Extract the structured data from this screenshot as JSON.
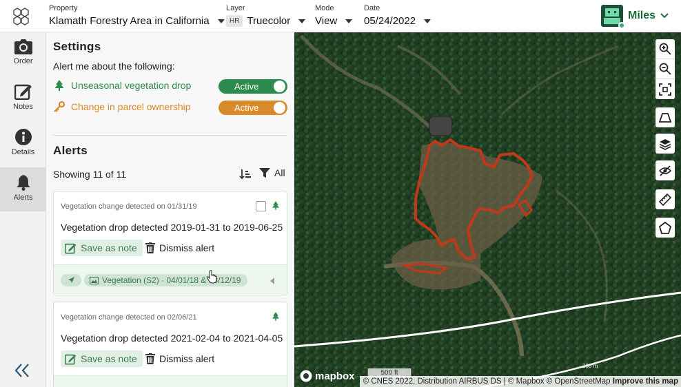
{
  "header": {
    "property": {
      "label": "Property",
      "value": "Klamath Forestry Area in California"
    },
    "layer": {
      "label": "Layer",
      "badge": "HR",
      "value": "Truecolor"
    },
    "mode": {
      "label": "Mode",
      "value": "View"
    },
    "date": {
      "label": "Date",
      "value": "05/24/2022"
    },
    "user": {
      "name": "Miles"
    }
  },
  "rail": {
    "items": [
      {
        "label": "Order",
        "icon": "camera-icon"
      },
      {
        "label": "Notes",
        "icon": "edit-icon"
      },
      {
        "label": "Details",
        "icon": "info-icon"
      },
      {
        "label": "Alerts",
        "icon": "bell-icon",
        "active": true
      }
    ]
  },
  "settings": {
    "title": "Settings",
    "intro": "Alert me about the following:",
    "rules": [
      {
        "label": "Unseasonal vegetation drop",
        "state": "Active",
        "color": "#2e8b4e",
        "icon": "tree-icon"
      },
      {
        "label": "Change in parcel ownership",
        "state": "Active",
        "color": "#d98a2b",
        "icon": "key-icon"
      }
    ]
  },
  "alerts": {
    "title": "Alerts",
    "showing": "Showing 11 of 11",
    "filter": "All",
    "cards": [
      {
        "detected": "Vegetation change detected on 01/31/19",
        "title": "Vegetation drop detected 2019-01-31 to 2019-06-25",
        "save": "Save as note",
        "dismiss": "Dismiss alert",
        "layer_pill": "Vegetation (S2) · 04/01/18 & 08/12/19"
      },
      {
        "detected": "Vegetation change detected on 02/06/21",
        "title": "Vegetation drop detected 2021-02-04 to 2021-04-05",
        "save": "Save as note",
        "dismiss": "Dismiss alert"
      }
    ]
  },
  "map": {
    "logo": "mapbox",
    "scale": "500 ft",
    "contour_label": "200 m",
    "attribution": {
      "text": "© CNES 2022, Distribution AIRBUS DS | © Mapbox © OpenStreetMap",
      "improve": "Improve this map"
    },
    "controls": [
      "zoom-in-icon",
      "zoom-out-icon",
      "fit-bounds-icon",
      "perspective-icon",
      "layers-icon",
      "hide-icon",
      "ruler-icon",
      "draw-polygon-icon"
    ]
  },
  "colors": {
    "brand_green": "#2e8b4e",
    "orange": "#d98a2b",
    "parcel_outline": "#c0391b"
  }
}
